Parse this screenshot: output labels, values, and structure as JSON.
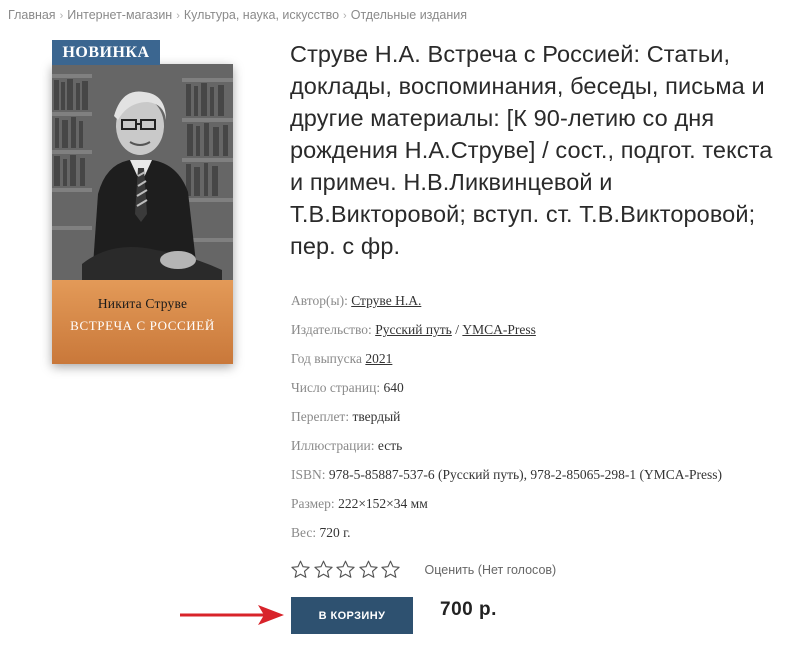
{
  "breadcrumb": [
    {
      "label": "Главная"
    },
    {
      "label": "Интернет-магазин"
    },
    {
      "label": "Культура, наука, искусство"
    },
    {
      "label": "Отдельные издания"
    }
  ],
  "badge": "НОВИНКА",
  "cover": {
    "author": "Никита Струве",
    "title": "ВСТРЕЧА С РОССИЕЙ"
  },
  "product_title": "Струве Н.А. Встреча с Россией: Статьи, доклады, воспоминания, беседы, письма и другие материалы: [К 90-летию со дня рождения Н.А.Струве] / сост., подгот. текста и примеч. Н.В.Ликвинцевой и Т.В.Викторовой; вступ. ст. Т.В.Викторовой; пер. с фр.",
  "props": {
    "author": {
      "label": "Автор(ы):",
      "value": "Струве Н.А."
    },
    "publisher": {
      "label": "Издательство:",
      "value1": "Русский путь",
      "divider": "/",
      "value2": "YMCA-Press"
    },
    "year": {
      "label": "Год выпуска",
      "value": "2021"
    },
    "pages": {
      "label": "Число страниц:",
      "value": "640"
    },
    "binding": {
      "label": "Переплет:",
      "value": "твердый"
    },
    "illustrations": {
      "label": "Иллюстрации:",
      "value": "есть"
    },
    "isbn": {
      "label": "ISBN:",
      "value": "978-5-85887-537-6 (Русский путь), 978-2-85065-298-1 (YMCA-Press)"
    },
    "size": {
      "label": "Размер:",
      "value": "222×152×34 мм"
    },
    "weight": {
      "label": "Вес:",
      "value": "720 г."
    }
  },
  "rating": {
    "label": "Оценить (Нет голосов)",
    "stars_filled": 0,
    "stars_total": 5
  },
  "cart_button": "В КОРЗИНУ",
  "price": "700 р.",
  "colors": {
    "badge": "#3b6690",
    "cart_button": "#2e5170",
    "arrow": "#d8232a",
    "cover_band": "#d98a4a"
  }
}
